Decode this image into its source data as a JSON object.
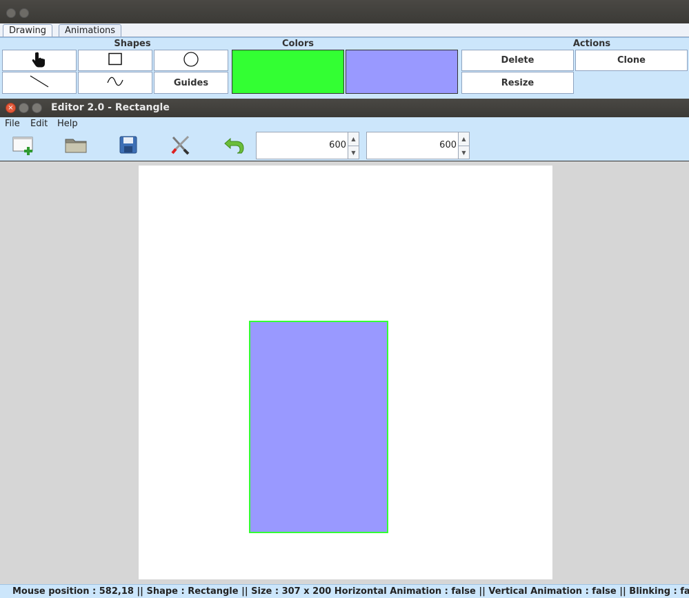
{
  "palette": {
    "tabs": [
      {
        "label": "Drawing",
        "active": true
      },
      {
        "label": "Animations",
        "active": false
      }
    ],
    "groups": {
      "shapes": "Shapes",
      "colors": "Colors",
      "actions": "Actions"
    },
    "shape_buttons": {
      "select": "select-hand-icon",
      "rectangle": "rectangle-icon",
      "circle": "circle-icon",
      "line": "line-icon",
      "curve": "curve-icon",
      "guides_label": "Guides"
    },
    "colors": {
      "border_color": "#33ff33",
      "fill_color": "#9999ff"
    },
    "actions": {
      "delete": "Delete",
      "clone": "Clone",
      "resize": "Resize"
    }
  },
  "editor": {
    "title": "Editor 2.0 - Rectangle",
    "menu": [
      "File",
      "Edit",
      "Help"
    ],
    "toolbar": {
      "icons": [
        "new-document-icon",
        "open-folder-icon",
        "save-icon",
        "tools-icon",
        "undo-icon"
      ],
      "width_value": "600",
      "height_value": "600"
    }
  },
  "canvas": {
    "background": "#ffffff",
    "shape": {
      "type": "Rectangle",
      "fill": "#9999ff",
      "stroke": "#33ff33"
    }
  },
  "status": {
    "text": "Mouse position : 582,18 || Shape : Rectangle || Size : 307 x 200 Horizontal Animation : false || Vertical Animation : false || Blinking : false ||"
  }
}
